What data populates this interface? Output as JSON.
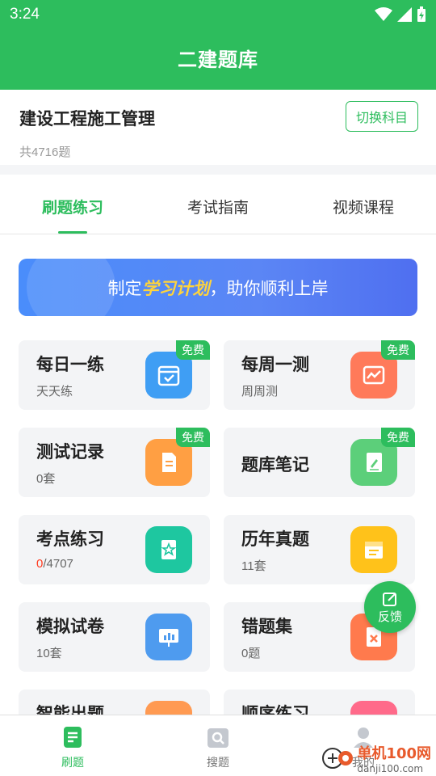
{
  "status": {
    "time": "3:24"
  },
  "app": {
    "title": "二建题库"
  },
  "subject": {
    "name": "建设工程施工管理",
    "count": "共4716题",
    "switch_label": "切换科目"
  },
  "tabs": [
    {
      "label": "刷题练习",
      "active": true
    },
    {
      "label": "考试指南",
      "active": false
    },
    {
      "label": "视频课程",
      "active": false
    }
  ],
  "banner": {
    "prefix": "制定",
    "highlight": "学习计划",
    "suffix": "，助你顺利上岸"
  },
  "cards": [
    {
      "title": "每日一练",
      "sub": "天天练",
      "badge": "免费",
      "icon": "calendar-check-icon",
      "color": "#3f9ef4"
    },
    {
      "title": "每周一测",
      "sub": "周周测",
      "badge": "免费",
      "icon": "chart-wave-icon",
      "color": "#ff7a5a"
    },
    {
      "title": "测试记录",
      "sub": "0套",
      "badge": "免费",
      "icon": "document-icon",
      "color": "#ff9f43"
    },
    {
      "title": "题库笔记",
      "sub": "",
      "badge": "免费",
      "icon": "notebook-icon",
      "color": "#5ccf7a"
    },
    {
      "title": "考点练习",
      "sub_done": "0",
      "sub_total": "/4707",
      "icon": "star-book-icon",
      "color": "#1ec7a0"
    },
    {
      "title": "历年真题",
      "sub": "11套",
      "icon": "calendar-list-icon",
      "color": "#ffc21a"
    },
    {
      "title": "模拟试卷",
      "sub": "10套",
      "icon": "presentation-icon",
      "color": "#4e9bef"
    },
    {
      "title": "错题集",
      "sub": "0题",
      "icon": "wrong-doc-icon",
      "color": "#ff7a4d"
    },
    {
      "title": "智能出题",
      "sub": "",
      "icon": "smart-icon",
      "color": "#ff9a52"
    },
    {
      "title": "顺序练习",
      "sub": "",
      "icon": "order-icon",
      "color": "#ff6a8a"
    }
  ],
  "feedback": {
    "label": "反馈"
  },
  "bottom_nav": [
    {
      "label": "刷题",
      "active": true
    },
    {
      "label": "搜题",
      "active": false
    },
    {
      "label": "我的",
      "active": false
    }
  ],
  "watermark": {
    "brand": "单机100网",
    "url": "danji100.com"
  }
}
